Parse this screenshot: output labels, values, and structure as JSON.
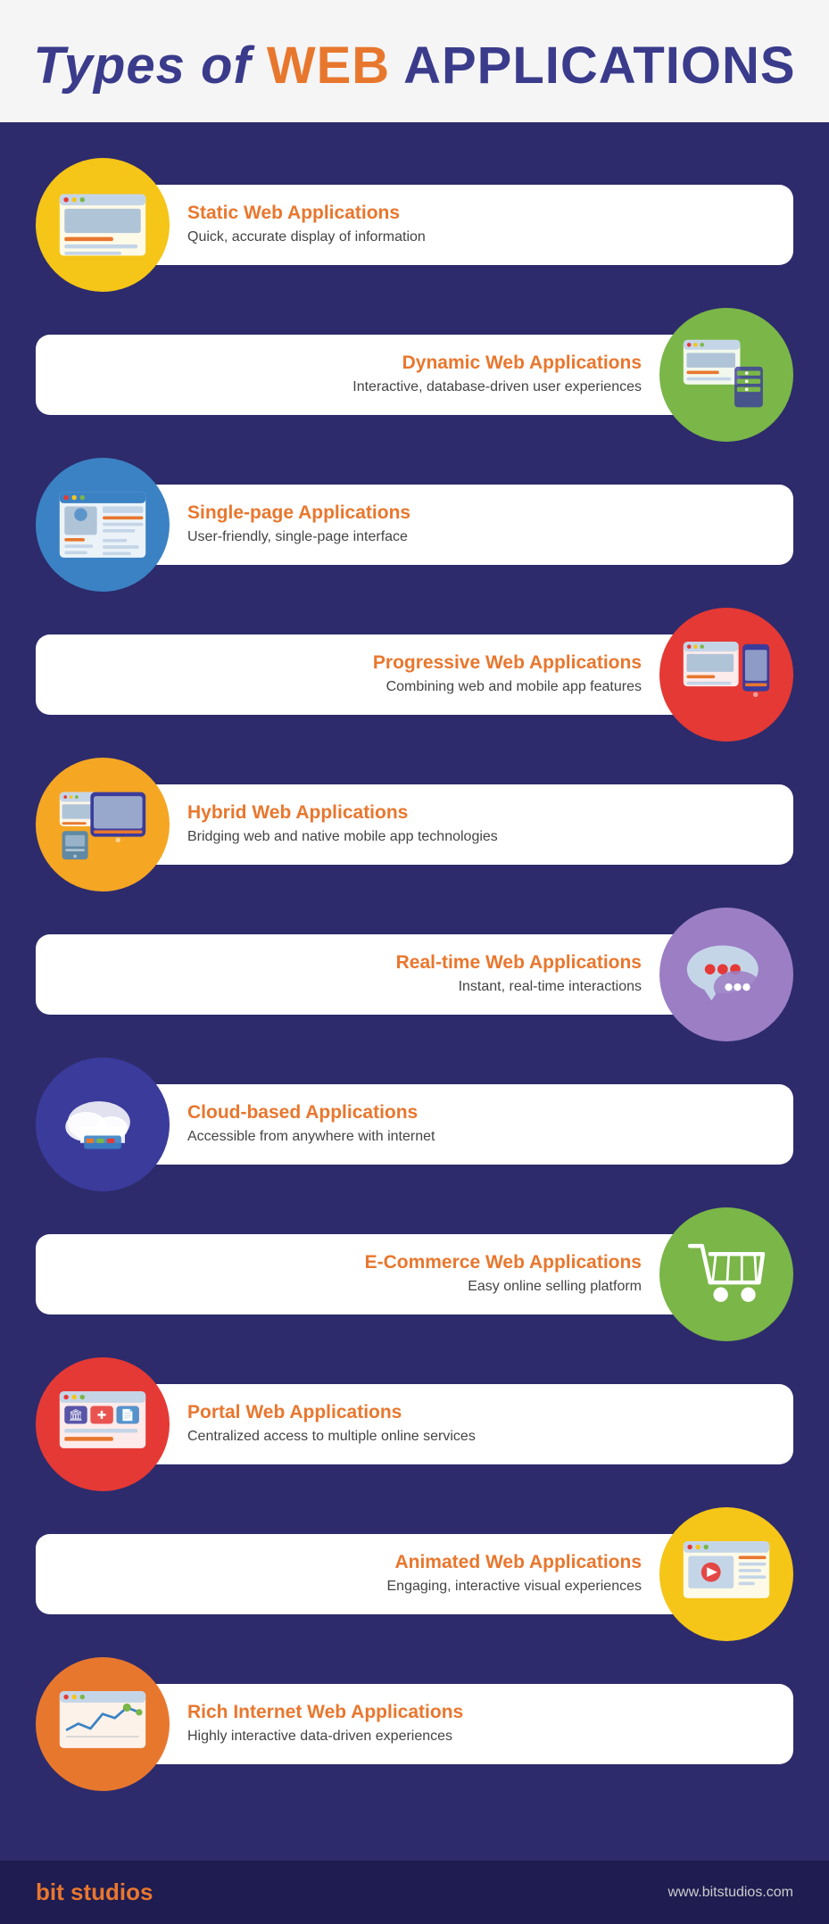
{
  "header": {
    "title_of": "Types of",
    "title_web": "WEB",
    "title_apps": "APPLICATIONS"
  },
  "apps": [
    {
      "id": "static",
      "title": "Static Web Applications",
      "desc": "Quick, accurate display of information",
      "icon_side": "left",
      "icon_color": "yellow-circle",
      "icon_type": "browser-basic"
    },
    {
      "id": "dynamic",
      "title": "Dynamic Web Applications",
      "desc": "Interactive, database-driven user experiences",
      "icon_side": "right",
      "icon_color": "green-circle",
      "icon_type": "browser-server"
    },
    {
      "id": "single-page",
      "title": "Single-page Applications",
      "desc": "User-friendly, single-page interface",
      "icon_side": "left",
      "icon_color": "blue-circle",
      "icon_type": "browser-spa"
    },
    {
      "id": "progressive",
      "title": "Progressive Web Applications",
      "desc": "Combining web and mobile app features",
      "icon_side": "right",
      "icon_color": "red-circle",
      "icon_type": "browser-mobile"
    },
    {
      "id": "hybrid",
      "title": "Hybrid Web Applications",
      "desc": "Bridging web and native mobile app technologies",
      "icon_side": "left",
      "icon_color": "orange-circle",
      "icon_type": "browser-tablet"
    },
    {
      "id": "realtime",
      "title": "Real-time Web Applications",
      "desc": "Instant, real-time interactions",
      "icon_side": "right",
      "icon_color": "purple-circle",
      "icon_type": "chat"
    },
    {
      "id": "cloud",
      "title": "Cloud-based Applications",
      "desc": "Accessible from anywhere with internet",
      "icon_side": "left",
      "icon_color": "indigo-circle",
      "icon_type": "cloud"
    },
    {
      "id": "ecommerce",
      "title": "E-Commerce Web Applications",
      "desc": "Easy online selling platform",
      "icon_side": "right",
      "icon_color": "green2-circle",
      "icon_type": "cart"
    },
    {
      "id": "portal",
      "title": "Portal Web Applications",
      "desc": "Centralized access to multiple online services",
      "icon_side": "left",
      "icon_color": "red2-circle",
      "icon_type": "portal"
    },
    {
      "id": "animated",
      "title": "Animated Web Applications",
      "desc": "Engaging, interactive visual experiences",
      "icon_side": "right",
      "icon_color": "yellow2-circle",
      "icon_type": "video"
    },
    {
      "id": "rich",
      "title": "Rich Internet Web Applications",
      "desc": "Highly interactive data-driven experiences",
      "icon_side": "left",
      "icon_color": "orange2-circle",
      "icon_type": "chart"
    }
  ],
  "footer": {
    "brand": "bit studios",
    "url": "www.bitstudios.com"
  }
}
